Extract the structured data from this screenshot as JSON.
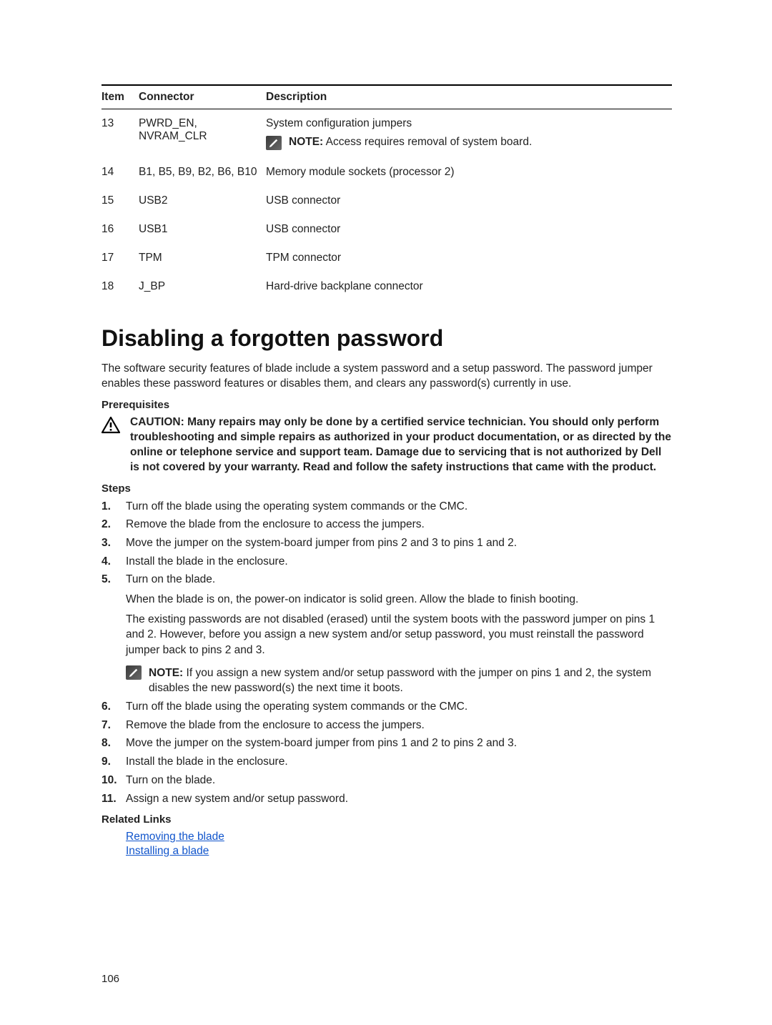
{
  "table": {
    "headers": {
      "item": "Item",
      "connector": "Connector",
      "description": "Description"
    },
    "rows": [
      {
        "item": "13",
        "connector": "PWRD_EN, NVRAM_CLR",
        "description": "System configuration jumpers",
        "note_label": "NOTE:",
        "note_text": " Access requires removal of system board."
      },
      {
        "item": "14",
        "connector": "B1, B5, B9, B2, B6, B10",
        "description": "Memory module sockets (processor 2)"
      },
      {
        "item": "15",
        "connector": "USB2",
        "description": "USB connector"
      },
      {
        "item": "16",
        "connector": "USB1",
        "description": "USB connector"
      },
      {
        "item": "17",
        "connector": "TPM",
        "description": "TPM connector"
      },
      {
        "item": "18",
        "connector": "J_BP",
        "description": "Hard-drive backplane connector"
      }
    ]
  },
  "section": {
    "title": "Disabling a forgotten password",
    "intro": "The software security features of blade include a system password and a setup password. The password jumper enables these password features or disables them, and clears any password(s) currently in use.",
    "prereq_heading": "Prerequisites",
    "caution_label": "CAUTION:",
    "caution_text": " Many repairs may only be done by a certified service technician. You should only perform troubleshooting and simple repairs as authorized in your product documentation, or as directed by the online or telephone service and support team. Damage due to servicing that is not authorized by Dell is not covered by your warranty. Read and follow the safety instructions that came with the product.",
    "steps_heading": "Steps",
    "steps": [
      {
        "text": "Turn off the blade using the operating system commands or the CMC."
      },
      {
        "text": "Remove the blade from the enclosure to access the jumpers."
      },
      {
        "text": "Move the jumper on the system-board jumper from pins 2 and 3 to pins 1 and 2."
      },
      {
        "text": "Install the blade in the enclosure."
      },
      {
        "text": "Turn on the blade.",
        "para1": "When the blade is on, the power-on indicator is solid green. Allow the blade to finish booting.",
        "para2": "The existing passwords are not disabled (erased) until the system boots with the password jumper on pins 1 and 2. However, before you assign a new system and/or setup password, you must reinstall the password jumper back to pins 2 and 3.",
        "note_label": "NOTE:",
        "note_text": " If you assign a new system and/or setup password with the jumper on pins 1 and 2, the system disables the new password(s) the next time it boots."
      },
      {
        "text": "Turn off the blade using the operating system commands or the CMC."
      },
      {
        "text": "Remove the blade from the enclosure to access the jumpers."
      },
      {
        "text": "Move the jumper on the system-board jumper from pins 1 and 2 to pins 2 and 3."
      },
      {
        "text": "Install the blade in the enclosure."
      },
      {
        "text": "Turn on the blade."
      },
      {
        "text": "Assign a new system and/or setup password."
      }
    ],
    "related_heading": "Related Links",
    "related_links": [
      {
        "label": "Removing the blade"
      },
      {
        "label": "Installing a blade"
      }
    ]
  },
  "page_number": "106"
}
